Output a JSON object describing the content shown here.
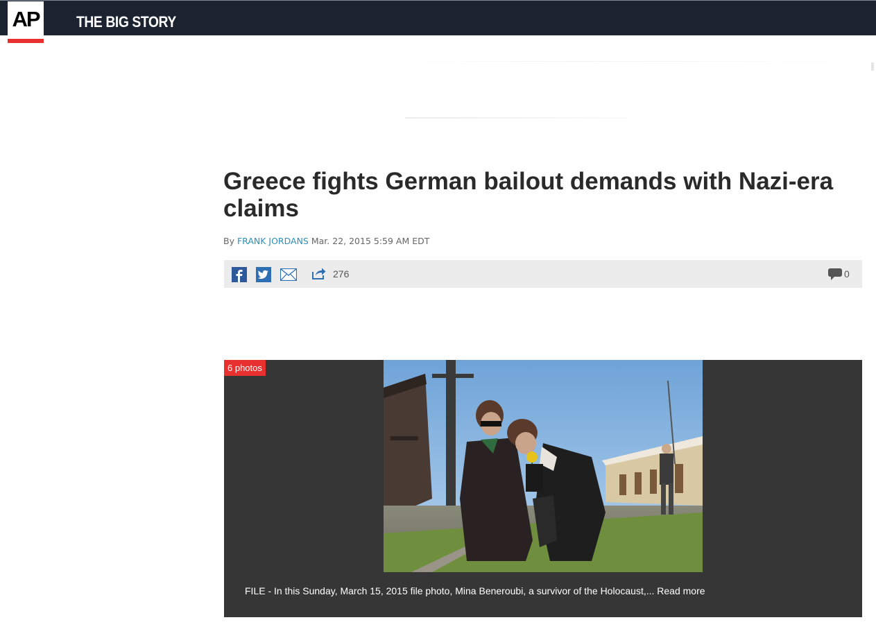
{
  "header": {
    "logo_text": "AP",
    "brand_name": "THE BIG STORY"
  },
  "article": {
    "headline": "Greece fights German bailout demands with Nazi-era claims",
    "byline_prefix": "By",
    "author": "FRANK JORDANS",
    "timestamp": "Mar. 22, 2015 5:59 AM EDT"
  },
  "share_bar": {
    "facebook_icon": "facebook-icon",
    "twitter_icon": "twitter-icon",
    "email_icon": "email-icon",
    "share_icon": "share-arrow-icon",
    "share_count": "276",
    "comment_icon": "comment-bubble-icon",
    "comment_count": "0"
  },
  "gallery": {
    "badge": "6 photos",
    "caption": "FILE - In this Sunday, March 15, 2015 file photo, Mina Beneroubi, a survivor of the Holocaust,...",
    "read_more": "Read more"
  },
  "colors": {
    "header_bg": "#1b2230",
    "accent_red": "#e8312f",
    "link_blue": "#2a8fb8",
    "gallery_bg": "#363636"
  }
}
